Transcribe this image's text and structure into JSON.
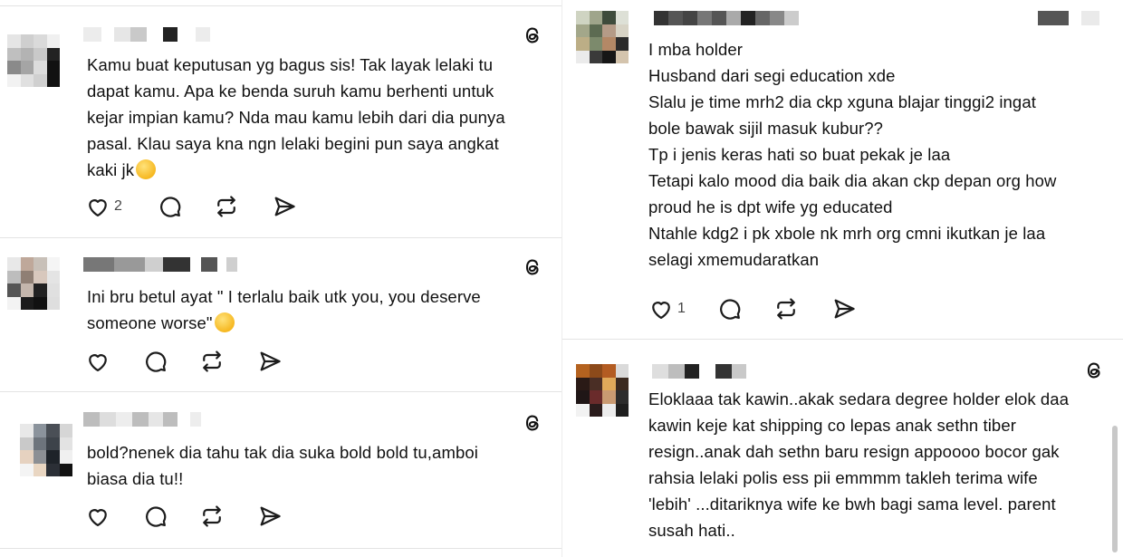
{
  "left": {
    "posts": [
      {
        "lines": [
          "Kamu buat keputusan yg bagus sis! Tak layak lelaki tu",
          "dapat kamu. Apa ke benda suruh kamu berhenti untuk",
          "kejar impian kamu? Nda mau kamu lebih dari dia punya",
          "pasal. Klau saya kna ngn lelaki begini pun saya angkat",
          "kaki jk"
        ],
        "emoji": "relieved-face-emoji",
        "like_count": "2"
      },
      {
        "lines": [
          "Ini bru betul  ayat \" I terlalu baik utk you, you deserve",
          "someone worse\""
        ],
        "emoji": "grinning-sweat-emoji",
        "like_count": ""
      },
      {
        "lines": [
          "bold?nenek dia tahu tak dia suka bold bold tu,amboi",
          "biasa dia tu!!"
        ],
        "like_count": ""
      }
    ]
  },
  "right": {
    "posts": [
      {
        "lines": [
          "I mba holder",
          "Husband dari segi education xde",
          "Slalu je time mrh2 dia ckp xguna blajar tinggi2 ingat",
          "bole bawak sijil masuk kubur??",
          "Tp i jenis keras hati so buat pekak je laa",
          "Tetapi kalo mood dia baik dia akan ckp depan org how",
          "proud he is dpt wife yg educated",
          "Ntahle kdg2 i pk xbole nk mrh org cmni ikutkan je laa",
          "selagi xmemudaratkan"
        ],
        "like_count": "1"
      },
      {
        "lines": [
          "Eloklaaa tak kawin..akak sedara degree holder elok daa",
          "kawin keje kat shipping co lepas anak sethn tiber",
          "resign..anak dah sethn baru resign appoooo bocor gak",
          "rahsia lelaki polis ess pii emmmm takleh terima wife",
          "'lebih' ...ditariknya wife ke bwh bagi sama level. parent",
          "susah hati.."
        ]
      }
    ]
  },
  "icons": {
    "like": "heart-icon",
    "reply": "comment-icon",
    "repost": "repost-icon",
    "share": "send-icon",
    "brand": "threads-logo-icon"
  },
  "colors": {
    "text": "#111111",
    "icon": "#1c1c1c",
    "separator": "#e3e3e3"
  }
}
